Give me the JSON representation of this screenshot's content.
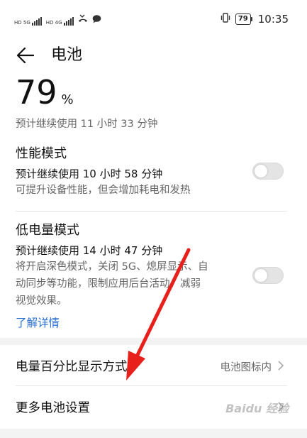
{
  "status_bar": {
    "sim1_tag": "HD 5G",
    "sim2_tag": "HD 4G",
    "battery_percent": "79",
    "time": "10:35",
    "icons": [
      "signal-icon",
      "missed-call-icon",
      "chat-icon",
      "vibrate-icon",
      "battery-icon"
    ]
  },
  "header": {
    "back_icon": "back-arrow-icon",
    "title": "电池"
  },
  "battery": {
    "level": "79",
    "unit": "%",
    "remaining": "预计继续使用 11 小时 33 分钟"
  },
  "performance_mode": {
    "title": "性能模式",
    "estimate": "预计继续使用 10 小时 58 分钟",
    "description": "可提升设备性能，但会增加耗电和发热",
    "enabled": false
  },
  "low_power_mode": {
    "title": "低电量模式",
    "estimate": "预计继续使用 14 小时 47 分钟",
    "description_lines": [
      "将开启深色模式，关闭 5G、熄屏显示、自",
      "动同步等功能，限制应用后台活动，减弱",
      "视觉效果。"
    ],
    "enabled": false
  },
  "learn_more": "了解详情",
  "settings": [
    {
      "label": "电量百分比显示方式",
      "value": "电池图标内"
    },
    {
      "label": "更多电池设置",
      "value": ""
    }
  ],
  "watermark": "Baidu 经验",
  "colors": {
    "accent": "#2a6fd6",
    "annotation_arrow": "#e8201c",
    "secondary_text": "#666666"
  }
}
